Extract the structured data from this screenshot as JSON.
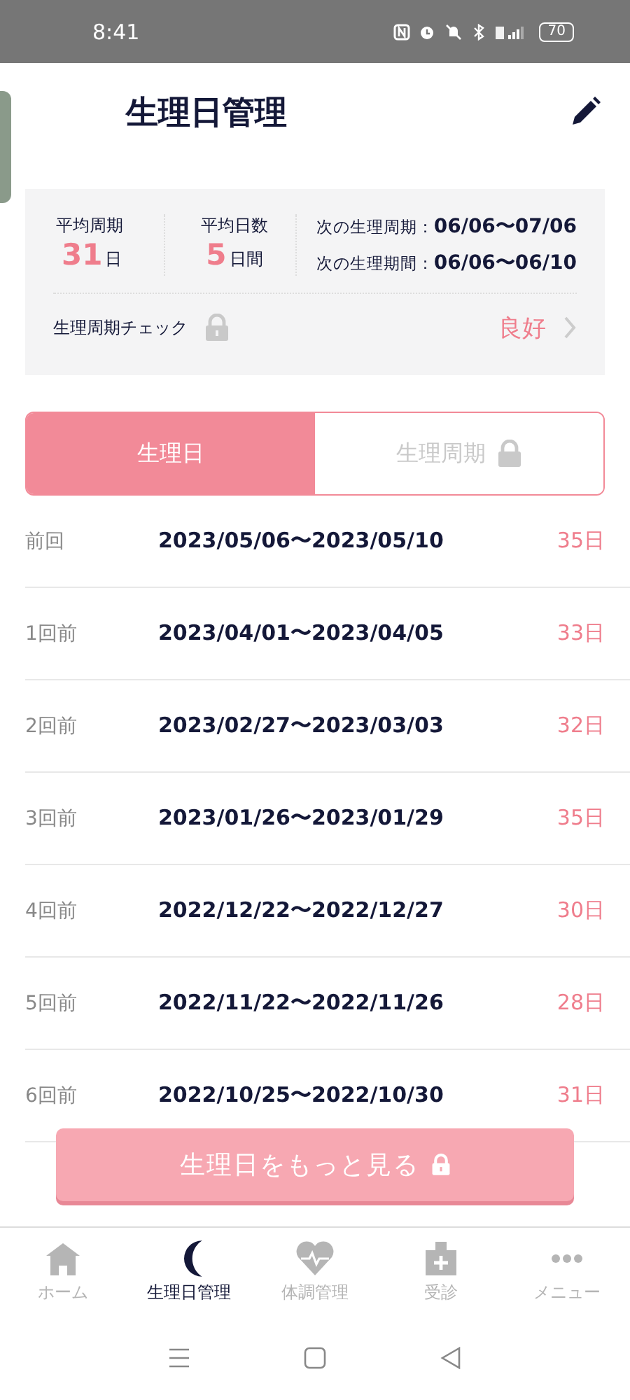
{
  "status_bar": {
    "time": "8:41",
    "battery": "70"
  },
  "header": {
    "title": "生理日管理"
  },
  "summary": {
    "stats": [
      {
        "label": "平均周期",
        "value": "31",
        "unit": "日"
      },
      {
        "label": "平均日数",
        "value": "5",
        "unit": "日間"
      }
    ],
    "next": [
      {
        "label": "次の生理周期：",
        "value": "06/06〜07/06"
      },
      {
        "label": "次の生理期間：",
        "value": "06/06〜06/10"
      }
    ],
    "check": {
      "label": "生理周期チェック",
      "locked": true,
      "result": "良好"
    }
  },
  "tabs": [
    {
      "label": "生理日",
      "selected": true,
      "locked": false
    },
    {
      "label": "生理周期",
      "selected": false,
      "locked": true
    }
  ],
  "history": [
    {
      "label": "前回",
      "range": "2023/05/06〜2023/05/10",
      "days": "35",
      "unit": "日"
    },
    {
      "label": "1回前",
      "range": "2023/04/01〜2023/04/05",
      "days": "33",
      "unit": "日"
    },
    {
      "label": "2回前",
      "range": "2023/02/27〜2023/03/03",
      "days": "32",
      "unit": "日"
    },
    {
      "label": "3回前",
      "range": "2023/01/26〜2023/01/29",
      "days": "35",
      "unit": "日"
    },
    {
      "label": "4回前",
      "range": "2022/12/22〜2022/12/27",
      "days": "30",
      "unit": "日"
    },
    {
      "label": "5回前",
      "range": "2022/11/22〜2022/11/26",
      "days": "28",
      "unit": "日"
    },
    {
      "label": "6回前",
      "range": "2022/10/25〜2022/10/30",
      "days": "31",
      "unit": "日"
    }
  ],
  "more_button": {
    "label": "生理日をもっと見る",
    "locked": true
  },
  "bottom_nav": [
    {
      "label": "ホーム",
      "selected": false
    },
    {
      "label": "生理日管理",
      "selected": true
    },
    {
      "label": "体調管理",
      "selected": false
    },
    {
      "label": "受診",
      "selected": false
    },
    {
      "label": "メニュー",
      "selected": false
    }
  ]
}
